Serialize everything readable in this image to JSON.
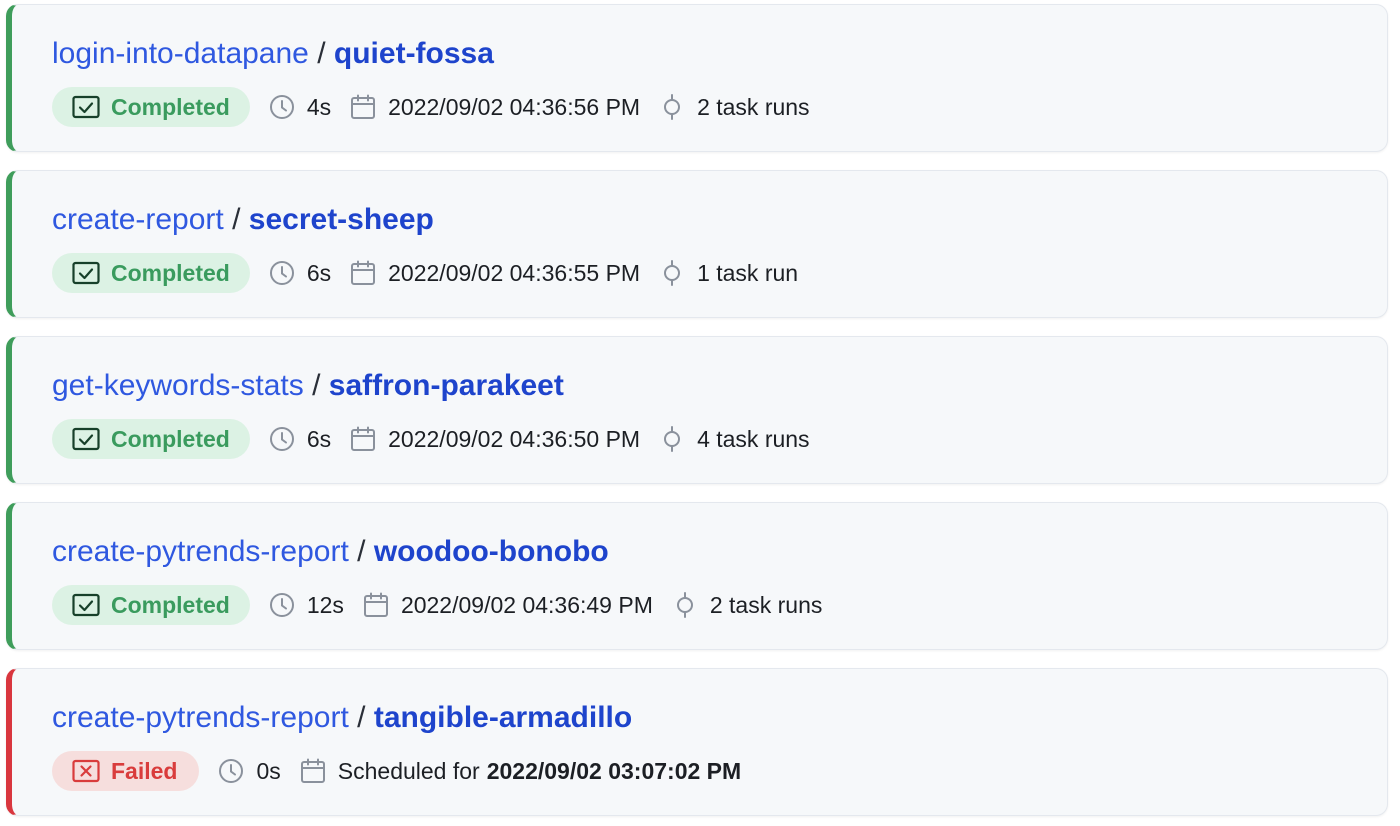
{
  "runs": [
    {
      "flow": "login-into-datapane",
      "separator": "/",
      "run": "quiet-fossa",
      "state": "Completed",
      "duration": "4s",
      "time": "2022/09/02 04:36:56 PM",
      "task_runs": "2 task runs"
    },
    {
      "flow": "create-report",
      "separator": "/",
      "run": "secret-sheep",
      "state": "Completed",
      "duration": "6s",
      "time": "2022/09/02 04:36:55 PM",
      "task_runs": "1 task run"
    },
    {
      "flow": "get-keywords-stats",
      "separator": "/",
      "run": "saffron-parakeet",
      "state": "Completed",
      "duration": "6s",
      "time": "2022/09/02 04:36:50 PM",
      "task_runs": "4 task runs"
    },
    {
      "flow": "create-pytrends-report",
      "separator": "/",
      "run": "woodoo-bonobo",
      "state": "Completed",
      "duration": "12s",
      "time": "2022/09/02 04:36:49 PM",
      "task_runs": "2 task runs"
    },
    {
      "flow": "create-pytrends-report",
      "separator": "/",
      "run": "tangible-armadillo",
      "state": "Failed",
      "duration": "0s",
      "scheduled_label": "Scheduled for",
      "time": "2022/09/02 03:07:02 PM"
    }
  ],
  "icons": {
    "completed": "check-square-icon",
    "failed": "x-square-icon",
    "duration": "clock-icon",
    "date": "calendar-icon",
    "task_runs": "commit-node-icon"
  },
  "colors": {
    "completed_accent": "#3f9d5b",
    "failed_accent": "#d9363e",
    "link": "#2f58e0"
  }
}
